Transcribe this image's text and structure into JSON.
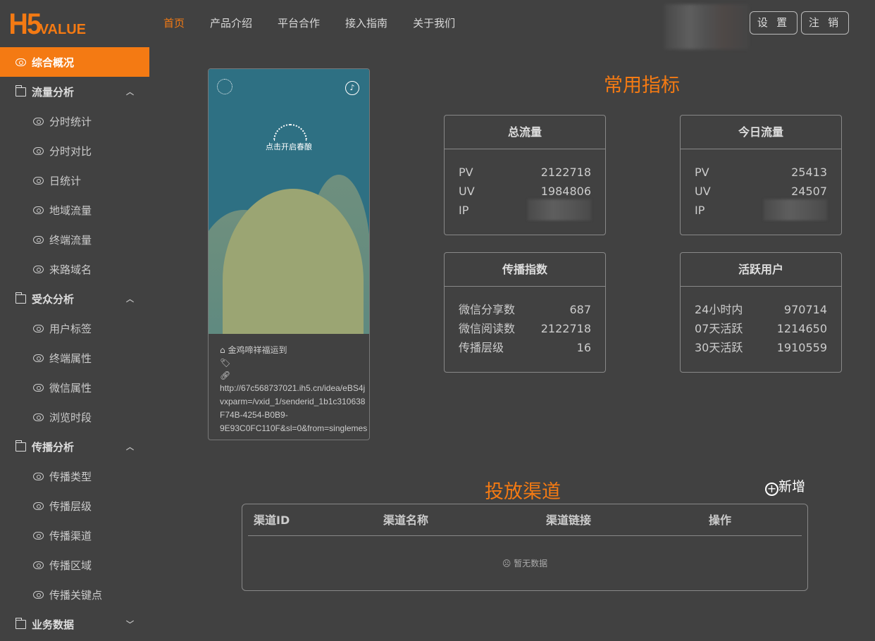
{
  "logo": {
    "main": "H5",
    "sub": "VALUE"
  },
  "nav": [
    "首页",
    "产品介绍",
    "平台合作",
    "接入指南",
    "关于我们"
  ],
  "header": {
    "settings": "设 置",
    "logout": "注 销"
  },
  "sidebar": {
    "overview": "综合概况",
    "groups": [
      {
        "label": "流量分析",
        "expanded": true,
        "items": [
          "分时统计",
          "分时对比",
          "日统计",
          "地域流量",
          "终端流量",
          "来路域名"
        ]
      },
      {
        "label": "受众分析",
        "expanded": true,
        "items": [
          "用户标签",
          "终端属性",
          "微信属性",
          "浏览时段"
        ]
      },
      {
        "label": "传播分析",
        "expanded": true,
        "items": [
          "传播类型",
          "传播层级",
          "传播渠道",
          "传播区域",
          "传播关键点"
        ]
      },
      {
        "label": "业务数据",
        "expanded": false,
        "items": []
      }
    ]
  },
  "preview": {
    "poster_text": "点击开启春酿",
    "title": "金鸡啼祥福运到",
    "url_lines": [
      " http://67c568737021.ih5.cn/idea/eBS4j",
      "vxparm=/vxid_1/senderid_1b1c310638",
      "F74B-4254-B0B9-",
      "9E93C0FC110F&sl=0&from=singlemes"
    ]
  },
  "metrics": {
    "title": "常用指标",
    "cards": [
      {
        "title": "总流量",
        "rows": [
          {
            "k": "PV",
            "v": "2122718"
          },
          {
            "k": "UV",
            "v": "1984806"
          },
          {
            "k": "IP",
            "v": null
          }
        ]
      },
      {
        "title": "今日流量",
        "rows": [
          {
            "k": "PV",
            "v": "25413"
          },
          {
            "k": "UV",
            "v": "24507"
          },
          {
            "k": "IP",
            "v": null
          }
        ]
      },
      {
        "title": "传播指数",
        "rows": [
          {
            "k": "微信分享数",
            "v": "687"
          },
          {
            "k": "微信阅读数",
            "v": "2122718"
          },
          {
            "k": "传播层级",
            "v": "16"
          }
        ]
      },
      {
        "title": "活跃用户",
        "rows": [
          {
            "k": "24小时内",
            "v": "970714"
          },
          {
            "k": "07天活跃",
            "v": "1214650"
          },
          {
            "k": "30天活跃",
            "v": "1910559"
          }
        ]
      }
    ]
  },
  "channels": {
    "title": "投放渠道",
    "add": "新增",
    "columns": [
      "渠道ID",
      "渠道名称",
      "渠道链接",
      "操作"
    ],
    "empty": "暂无数据"
  },
  "colors": {
    "accent": "#f47a13",
    "bg": "#414141"
  }
}
